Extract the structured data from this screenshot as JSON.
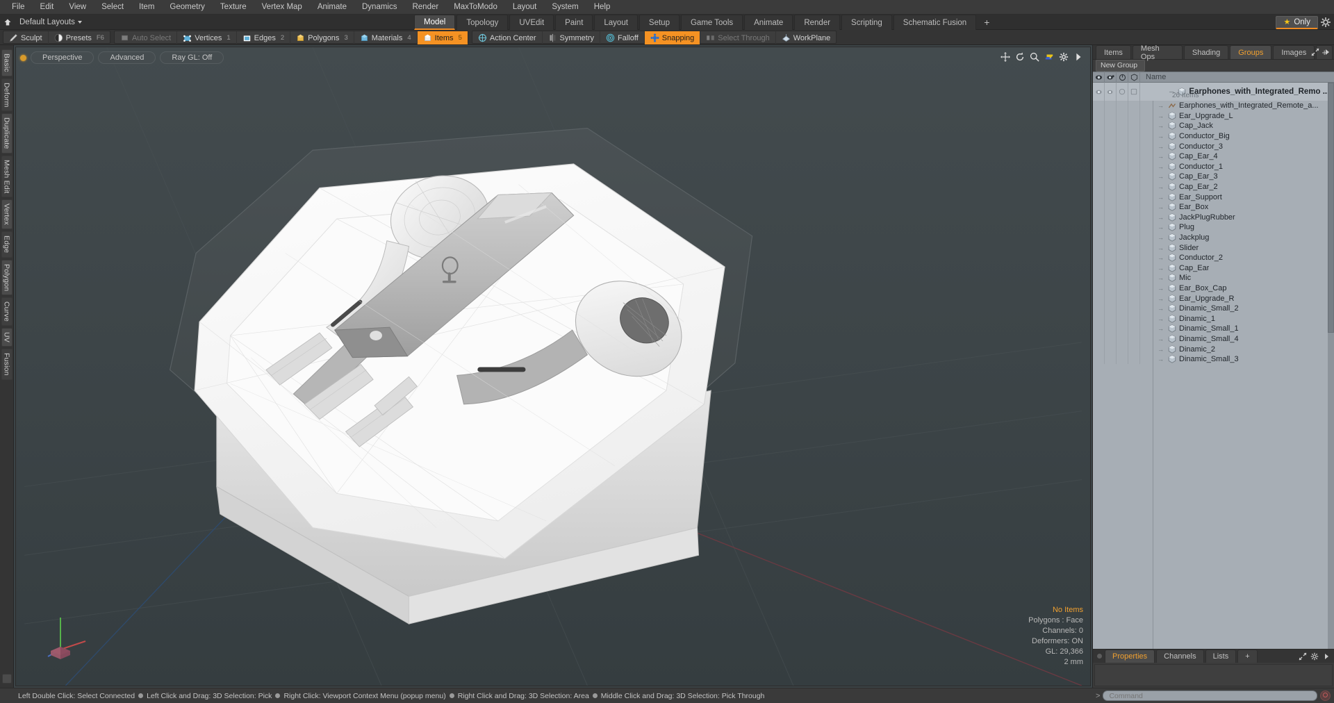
{
  "menubar": {
    "items": [
      "File",
      "Edit",
      "View",
      "Select",
      "Item",
      "Geometry",
      "Texture",
      "Vertex Map",
      "Animate",
      "Dynamics",
      "Render",
      "MaxToModo",
      "Layout",
      "System",
      "Help"
    ]
  },
  "layoutbar": {
    "home_icon": "home-icon",
    "layouts_label": "Default Layouts",
    "tabs": [
      {
        "label": "Model",
        "active": true
      },
      {
        "label": "Topology",
        "active": false
      },
      {
        "label": "UVEdit",
        "active": false
      },
      {
        "label": "Paint",
        "active": false
      },
      {
        "label": "Layout",
        "active": false
      },
      {
        "label": "Setup",
        "active": false
      },
      {
        "label": "Game Tools",
        "active": false
      },
      {
        "label": "Animate",
        "active": false
      },
      {
        "label": "Render",
        "active": false
      },
      {
        "label": "Scripting",
        "active": false
      },
      {
        "label": "Schematic Fusion",
        "active": false
      }
    ],
    "add_label": "+",
    "only_label": "Only",
    "gear_icon": "gear-icon"
  },
  "modebar": {
    "groups": [
      {
        "buttons": [
          {
            "label": "Sculpt",
            "icon": "sculpt-icon",
            "state": "normal",
            "num": ""
          },
          {
            "label": "Presets",
            "icon": "presets-icon",
            "state": "normal",
            "num": "F6"
          }
        ]
      },
      {
        "buttons": [
          {
            "label": "Auto Select",
            "icon": "autoselect-icon",
            "state": "dim",
            "num": ""
          },
          {
            "label": "Vertices",
            "icon": "vertices-icon",
            "state": "normal",
            "num": "1"
          },
          {
            "label": "Edges",
            "icon": "edges-icon",
            "state": "normal",
            "num": "2"
          },
          {
            "label": "Polygons",
            "icon": "polygons-icon",
            "state": "normal",
            "num": "3"
          },
          {
            "label": "Materials",
            "icon": "materials-icon",
            "state": "normal",
            "num": "4"
          },
          {
            "label": "Items",
            "icon": "items-icon",
            "state": "on",
            "num": "5"
          }
        ]
      },
      {
        "buttons": [
          {
            "label": "Action Center",
            "icon": "action-center-icon",
            "state": "normal",
            "num": ""
          },
          {
            "label": "Symmetry",
            "icon": "symmetry-icon",
            "state": "normal",
            "num": ""
          },
          {
            "label": "Falloff",
            "icon": "falloff-icon",
            "state": "normal",
            "num": ""
          },
          {
            "label": "Snapping",
            "icon": "snapping-icon",
            "state": "on",
            "num": ""
          },
          {
            "label": "Select Through",
            "icon": "select-through-icon",
            "state": "dim",
            "num": ""
          },
          {
            "label": "WorkPlane",
            "icon": "workplane-icon",
            "state": "normal",
            "num": ""
          }
        ]
      }
    ]
  },
  "left_tabs": [
    "Basic",
    "Deform",
    "Duplicate",
    "Mesh Edit",
    "Vertex",
    "Edge",
    "Polygon",
    "Curve",
    "UV",
    "Fusion"
  ],
  "viewport": {
    "view_label": "Perspective",
    "shading_label": "Advanced",
    "raygl_label": "Ray GL: Off",
    "tool_icons": [
      "move-icon",
      "rotate-icon",
      "zoom-icon",
      "flip-icon",
      "gear-icon",
      "chevron-right-icon"
    ],
    "stats": {
      "selection": "No Items",
      "polygons": "Polygons : Face",
      "channels": "Channels: 0",
      "deformers": "Deformers: ON",
      "gl": "GL: 29,366",
      "units": "2 mm"
    }
  },
  "right_panel": {
    "tabs": [
      {
        "label": "Items",
        "active": false
      },
      {
        "label": "Mesh Ops",
        "active": false
      },
      {
        "label": "Shading",
        "active": false
      },
      {
        "label": "Groups",
        "active": true
      },
      {
        "label": "Images",
        "active": false
      }
    ],
    "add_label": "+",
    "expand_icon": "expand-icon",
    "chevron_icon": "chevron-right-icon",
    "new_group_label": "New Group",
    "columns": [
      "eye-icon",
      "render-icon",
      "lock-icon",
      "select-icon"
    ],
    "name_header": "Name",
    "group": {
      "name": "Earphones_with_Integrated_Remo ...",
      "count": "26 Items"
    },
    "items": [
      "Earphones_with_Integrated_Remote_a...",
      "Ear_Upgrade_L",
      "Cap_Jack",
      "Conductor_Big",
      "Conductor_3",
      "Cap_Ear_4",
      "Conductor_1",
      "Cap_Ear_3",
      "Cap_Ear_2",
      "Ear_Support",
      "Ear_Box",
      "JackPlugRubber",
      "Plug",
      "Jackplug",
      "Slider",
      "Conductor_2",
      "Cap_Ear",
      "Mic",
      "Ear_Box_Cap",
      "Ear_Upgrade_R",
      "Dinamic_Small_2",
      "Dinamic_1",
      "Dinamic_Small_1",
      "Dinamic_Small_4",
      "Dinamic_2",
      "Dinamic_Small_3"
    ]
  },
  "properties_panel": {
    "tabs": [
      {
        "label": "Properties",
        "active": true
      },
      {
        "label": "Channels",
        "active": false
      },
      {
        "label": "Lists",
        "active": false
      }
    ],
    "add_label": "+",
    "expand_icon": "expand-icon",
    "gear_icon": "gear-icon"
  },
  "statusbar": {
    "hints": [
      "Left Double Click: Select Connected",
      "Left Click and Drag: 3D Selection: Pick",
      "Right Click: Viewport Context Menu (popup menu)",
      "Right Click and Drag: 3D Selection: Area",
      "Middle Click and Drag: 3D Selection: Pick Through"
    ],
    "command_prompt": ">",
    "command_placeholder": "Command",
    "command_value": "",
    "record_icon": "record-icon"
  },
  "colors": {
    "accent": "#f59223",
    "highlight": "#f0a030",
    "panel_bg": "#3b3b3b",
    "list_bg": "#a7aeb5",
    "viewport_bg": "#3c4447"
  }
}
